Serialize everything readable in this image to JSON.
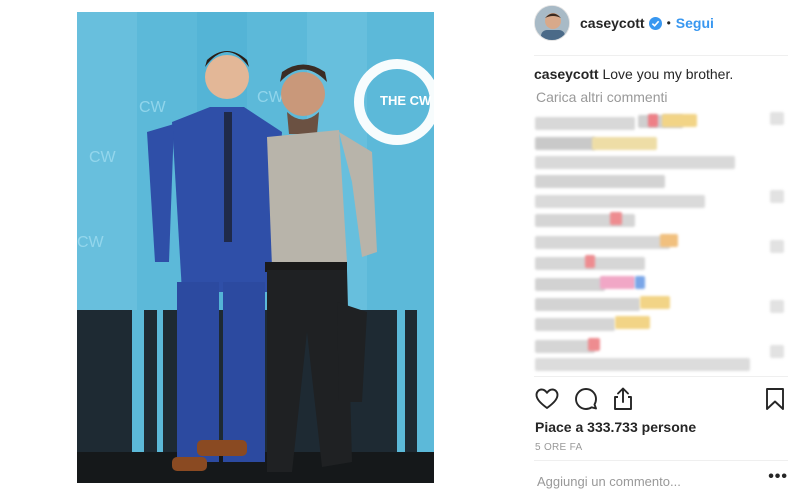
{
  "post": {
    "username": "caseycott",
    "follow_label": "Segui",
    "dot": "•",
    "caption_user": "caseycott",
    "caption_text": "Love you my brother.",
    "load_more": "Carica altri commenti",
    "likes": "Piace a 333.733 persone",
    "time": "5 ORE FA",
    "comment_placeholder": "Aggiungi un commento...",
    "more_options": "•••",
    "photo_logo": "THE CW"
  },
  "icons": {
    "verified": "verified-badge-icon",
    "like": "heart-icon",
    "comment": "comment-icon",
    "share": "share-icon",
    "save": "bookmark-icon"
  },
  "colors": {
    "link_blue": "#3897f0",
    "text": "#262626",
    "muted": "#999999",
    "backdrop": "#5cb9d9"
  }
}
